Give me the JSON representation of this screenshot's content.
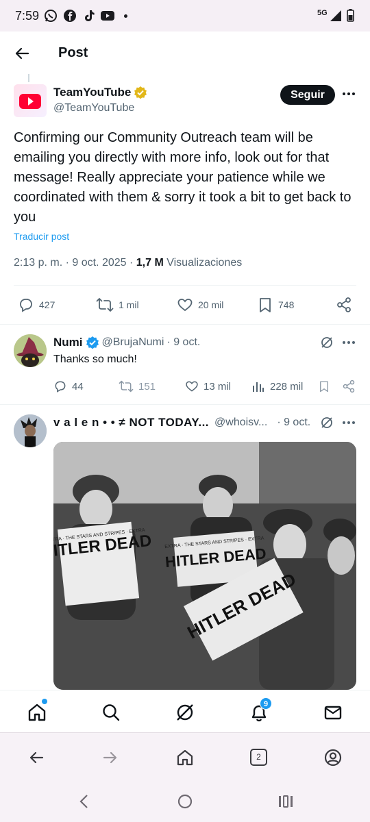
{
  "status_bar": {
    "time": "7:59",
    "network": "5G"
  },
  "header": {
    "title": "Post"
  },
  "post": {
    "author_name": "TeamYouTube",
    "author_handle": "@TeamYouTube",
    "follow_label": "Seguir",
    "text": "Confirming our Community Outreach team will be emailing you directly with more info, look out for that message! Really appreciate your patience while we coordinated with them & sorry it took a bit to get back to you",
    "translate_label": "Traducir post",
    "timestamp": "2:13 p. m. · 9 oct. 2025 ·",
    "views_count": "1,7 M",
    "views_label": "Visualizaciones",
    "replies": "427",
    "reposts": "1 mil",
    "likes": "20 mil",
    "bookmarks": "748"
  },
  "replies": [
    {
      "name": "Numi",
      "handle": "@BrujaNumi",
      "time": "· 9 oct.",
      "text": "Thanks so much!",
      "comments": "44",
      "reposts": "151",
      "likes": "13 mil",
      "views": "228 mil"
    },
    {
      "name": "v a l e n • • ≠ NOT TODAY...",
      "handle": "@whoisv...",
      "time": "· 9 oct.",
      "image_text_1": "HITLER DEAD",
      "image_text_2": "HITLER DEAD",
      "image_text_3": "HITLER DEAD"
    }
  ],
  "bottom_nav": {
    "notifications_badge": "9"
  },
  "browser_bar": {
    "tab_count": "2"
  },
  "colors": {
    "accent": "#1d9bf0",
    "text": "#0f1419",
    "muted": "#536471",
    "youtube_red": "#ff0033"
  }
}
